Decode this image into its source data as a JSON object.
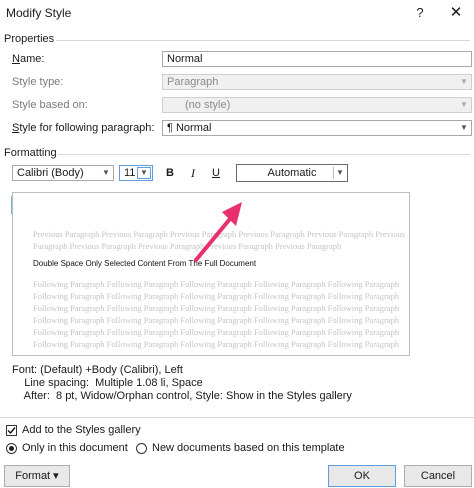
{
  "window": {
    "title": "Modify Style",
    "help": "?",
    "close": "✕"
  },
  "properties": {
    "section": "Properties",
    "name_label": "Name:",
    "name_value": "Normal",
    "style_type_label": "Style type:",
    "style_type_value": "Paragraph",
    "based_on_label": "Style based on:",
    "based_on_value": "(no style)",
    "following_label": "Style for following paragraph:",
    "following_value": "¶  Normal"
  },
  "formatting": {
    "section": "Formatting",
    "font": "Calibri (Body)",
    "size": "11",
    "bold": "B",
    "italic": "I",
    "underline": "U",
    "color": "Automatic"
  },
  "preview": {
    "previous_line_1": "Previous Paragraph Previous Paragraph Previous Paragraph Previous Paragraph Previous Paragraph Previous",
    "previous_line_2": "Paragraph Previous Paragraph Previous Paragraph Previous Paragraph Previous Paragraph",
    "sample": "Double Space Only Selected Content From The Full Document",
    "following_line": "Following Paragraph Following Paragraph Following Paragraph Following Paragraph Following Paragraph"
  },
  "description": {
    "line1": "Font: (Default) +Body (Calibri), Left",
    "line2": "    Line spacing:  Multiple 1.08 li, Space",
    "line3": "    After:  8 pt, Widow/Orphan control, Style: Show in the Styles gallery"
  },
  "options": {
    "add_to_gallery": "Add to the Styles gallery",
    "only_this_doc": "Only in this document",
    "new_docs": "New documents based on this template"
  },
  "buttons": {
    "format": "Format ▾",
    "ok": "OK",
    "cancel": "Cancel"
  },
  "colors": {
    "highlight_arrow": "#e8306f",
    "active_button": "#cde4f7"
  }
}
